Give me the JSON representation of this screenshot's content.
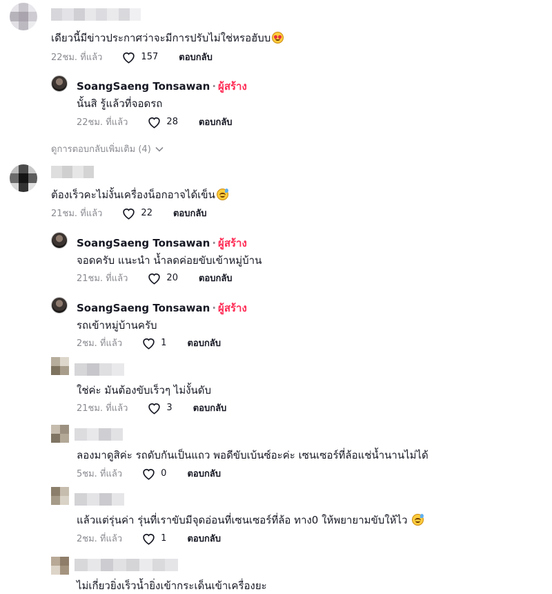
{
  "labels": {
    "reply": "ตอบกลับ",
    "creator_tag": "ผู้สร้าง",
    "separator": "·"
  },
  "creator_name": "SoangSaeng Tonsawan",
  "comments": [
    {
      "text": "เดียวนี้มีข่าวประกาศว่าจะมีการปรับไม่ใช่หรอฮับบ",
      "emoji": "smiling-face-with-hearts",
      "time": "22ชม. ที่แล้ว",
      "likes": "157"
    },
    {
      "text": "นั้นสิ รู้แล้วที่จอดรถ",
      "time": "22ชม. ที่แล้ว",
      "likes": "28"
    },
    {
      "text": "ต้องเร็วคะไม่งั้นเครื่องน็อกอาจได้เข็น",
      "emoji": "grinning-face-with-sweat",
      "time": "21ชม. ที่แล้ว",
      "likes": "22"
    },
    {
      "text": "จอดครับ แนะนำ น้ำลดค่อยขับเข้าหมู่บ้าน",
      "time": "21ชม. ที่แล้ว",
      "likes": "20"
    },
    {
      "text": "รถเข้าหมู่บ้านครับ",
      "time": "2ชม. ที่แล้ว",
      "likes": "1"
    },
    {
      "text": "ใช่ค่ะ มันต้องขับเร็วๆ ไม่งั้นดับ",
      "time": "21ชม. ที่แล้ว",
      "likes": "3"
    },
    {
      "text": "ลองมาดูสิค่ะ รถดับกันเป็นแถว พอดีขับเบ้นซ์อะค่ะ เซนเซอร์ที่ล้อแช่น้ำนานไม่ได้",
      "time": "5ชม. ที่แล้ว",
      "likes": "0"
    },
    {
      "text": "แล้วแต่รุ่นค่า รุ่นที่เราขับมีจุดอ่อนที่เซนเซอร์ที่ล้อ ทาง0 ให้พยายามขับให้ไว",
      "emoji": "grinning-face-with-sweat",
      "time": "2ชม. ที่แล้ว",
      "likes": "1"
    },
    {
      "text": "ไม่เกี่ยวยิ่งเร็วน้ำยิ่งเข้ากระเด็นเข้าเครื่องยะ"
    }
  ],
  "view_more": "ดูการตอบกลับเพิ่มเติม (4)",
  "icons": {
    "like": "heart-outline-icon",
    "expand": "chevron-down-icon"
  }
}
